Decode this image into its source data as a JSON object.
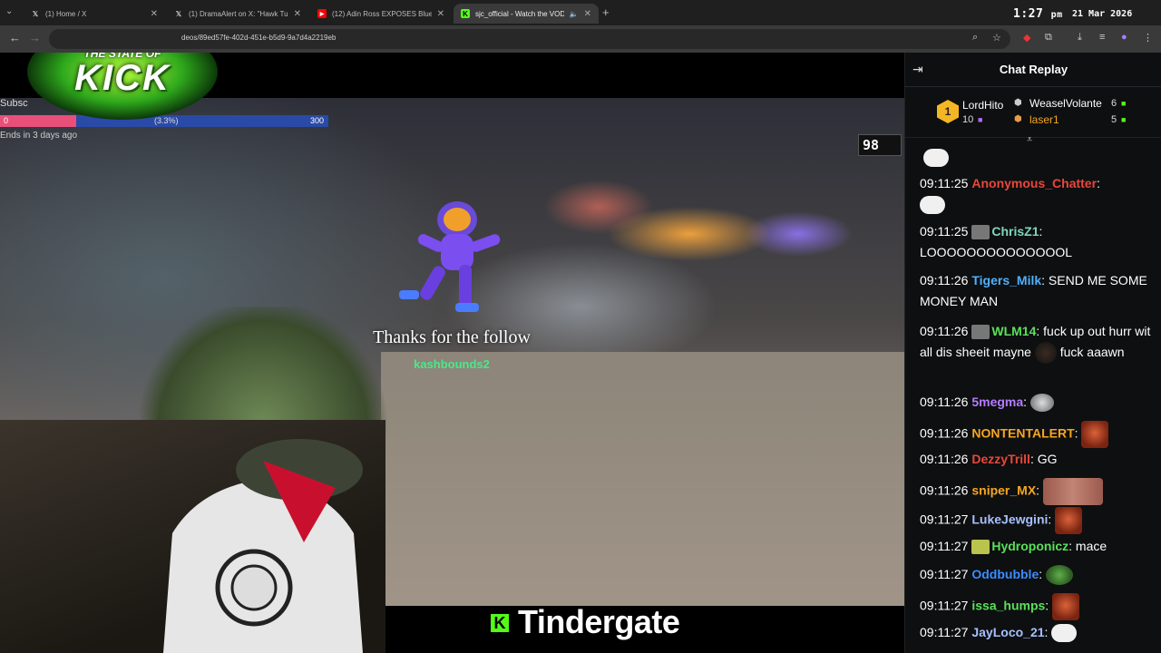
{
  "browser": {
    "tabs": [
      {
        "title": "(1) Home / X",
        "icon": "x-logo-icon"
      },
      {
        "title": "(1) DramaAlert on X: \"Hawk Tu",
        "icon": "x-logo-icon"
      },
      {
        "title": "(12) Adin Ross EXPOSES Bluefa",
        "icon": "youtube-icon"
      },
      {
        "title": "sjc_official - Watch the VOD",
        "icon": "kick-icon"
      }
    ],
    "url": "deos/89ed57fe-402d-451e-b5d9-9a7d4a2219eb",
    "clock_time": "1:27",
    "clock_ampm": "pm",
    "clock_date": "21 Mar 2026"
  },
  "overlay": {
    "logo_top": "THE STATE OF",
    "logo_main": "KICK",
    "sub_goal_label": "Subsc",
    "progress_start": "0",
    "progress_pct": "(3.3%)",
    "progress_end": "300",
    "progress_fraction": 0.033,
    "ends_text": "Ends in 3 days ago",
    "fps": "98",
    "alert_text": "Thanks for the follow",
    "alert_user": "kashbounds2",
    "banner_text": "Tindergate"
  },
  "chat": {
    "title": "Chat Replay",
    "leaderboard": {
      "first": {
        "rank": "1",
        "name": "LordHito",
        "count": "10"
      },
      "second": {
        "name": "WeaselVolante",
        "count": "6"
      },
      "third": {
        "name": "laser1",
        "count": "5"
      }
    },
    "messages": [
      {
        "ts": "09:11:25",
        "user": "Anonymous_Chatter",
        "color": "#e8473c",
        "text": ""
      },
      {
        "ts": "09:11:25",
        "user": "ChrisZ1",
        "color": "#7fd7b7",
        "text": "LOOOOOOOOOOOOOOL"
      },
      {
        "ts": "09:11:26",
        "user": "Tigers_Milk",
        "color": "#4fb0ff",
        "text": "SEND ME SOME MONEY MAN"
      },
      {
        "ts": "09:11:26",
        "user": "WLM14",
        "color": "#59e05a",
        "text": "fuck up out hurr wit all dis sheeit mayne"
      },
      {
        "ts": "",
        "user": "",
        "color": "#fff",
        "text": "fuck aaawn"
      },
      {
        "ts": "09:11:26",
        "user": "5megma",
        "color": "#b47cff",
        "text": ""
      },
      {
        "ts": "09:11:26",
        "user": "NONTENTALERT",
        "color": "#f5a623",
        "text": ""
      },
      {
        "ts": "09:11:26",
        "user": "DezzyTrill",
        "color": "#e8473c",
        "text": "GG"
      },
      {
        "ts": "09:11:26",
        "user": "sniper_MX",
        "color": "#f5a623",
        "text": ""
      },
      {
        "ts": "09:11:27",
        "user": "LukeJewgini",
        "color": "#a6c0ff",
        "text": ""
      },
      {
        "ts": "09:11:27",
        "user": "Hydroponicz",
        "color": "#59e05a",
        "text": "mace"
      },
      {
        "ts": "09:11:27",
        "user": "Oddbubble",
        "color": "#3b8cff",
        "text": ""
      },
      {
        "ts": "09:11:27",
        "user": "issa_humps",
        "color": "#59e05a",
        "text": ""
      },
      {
        "ts": "09:11:27",
        "user": "JayLoco_21",
        "color": "#a6c0ff",
        "text": ""
      }
    ]
  }
}
